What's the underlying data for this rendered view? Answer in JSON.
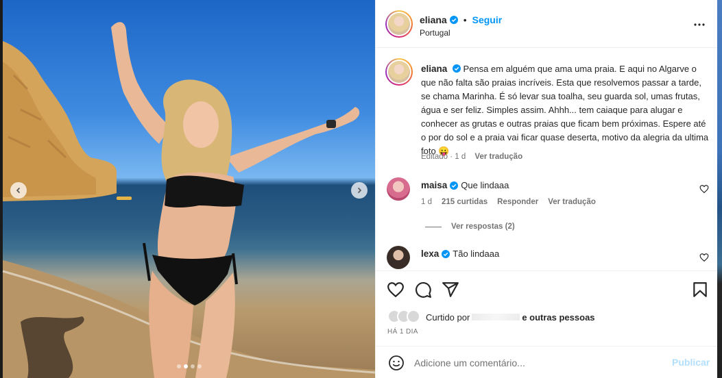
{
  "colors": {
    "accent": "#0095f6",
    "publish_disabled": "#b2dffc",
    "text": "#262626",
    "muted": "#737373"
  },
  "media": {
    "dots_count": 4,
    "active_dot": 1
  },
  "header": {
    "username": "eliana",
    "separator": "•",
    "follow_label": "Seguir",
    "location": "Portugal"
  },
  "caption": {
    "username": "eliana",
    "text": "Pensa em alguém que ama uma praia. E aqui no Algarve o que não falta são praias incríveis. Esta que resolvemos passar a tarde, se chama Marinha. É só levar sua toalha, seu guarda sol, umas frutas, água e ser feliz. Simples assim. Ahhh... tem caiaque para alugar e conhecer as grutas e outras praias que ficam bem próximas. Espere até o por do sol e a praia vai ficar quase deserta, motivo da alegria da ultima foto 😛",
    "edited": "Editado · 1 d",
    "translate": "Ver tradução"
  },
  "comments": [
    {
      "username": "maisa",
      "text": "Que lindaaa",
      "age": "1 d",
      "likes": "215 curtidas",
      "reply": "Responder",
      "translate": "Ver tradução",
      "replies_label": "Ver respostas (2)"
    },
    {
      "username": "lexa",
      "text": "Tão lindaaa"
    }
  ],
  "actions": {
    "liked_prefix": "Curtido por",
    "liked_suffix": "e outras pessoas",
    "time": "HÁ 1 DIA"
  },
  "add_comment": {
    "placeholder": "Adicione um comentário...",
    "publish_label": "Publicar"
  },
  "icons": [
    "more-icon",
    "heart-icon",
    "comment-icon",
    "share-icon",
    "save-icon",
    "emoji-icon",
    "verified-icon",
    "chevron-left-icon",
    "chevron-right-icon"
  ]
}
